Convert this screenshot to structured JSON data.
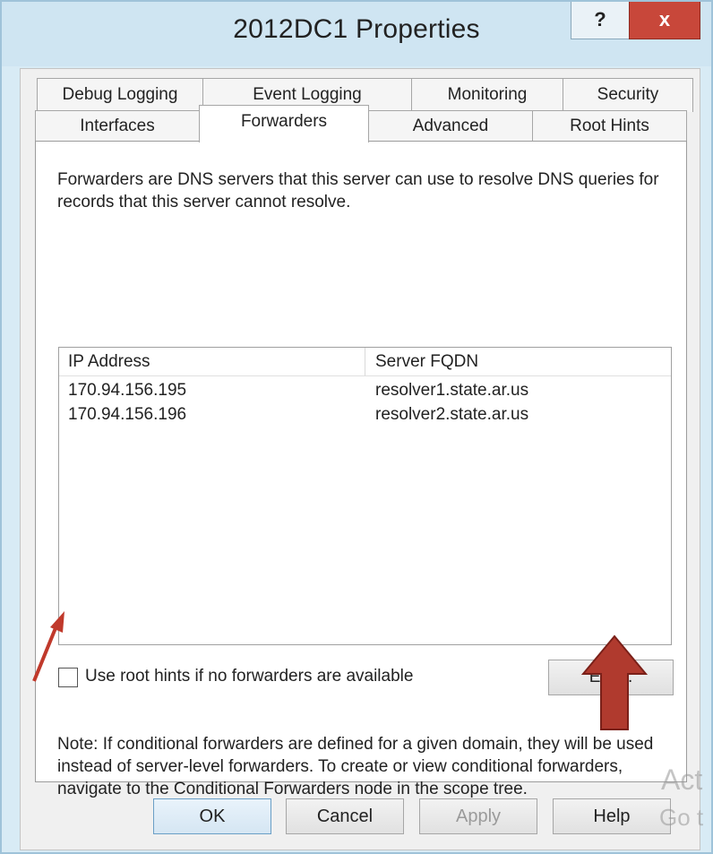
{
  "window": {
    "title": "2012DC1 Properties",
    "help_label": "?",
    "close_label": "x"
  },
  "tabs_row1": [
    {
      "label": "Debug Logging"
    },
    {
      "label": "Event Logging"
    },
    {
      "label": "Monitoring"
    },
    {
      "label": "Security"
    }
  ],
  "tabs_row2": [
    {
      "label": "Interfaces"
    },
    {
      "label": "Forwarders",
      "active": true
    },
    {
      "label": "Advanced"
    },
    {
      "label": "Root Hints"
    }
  ],
  "panel": {
    "description": "Forwarders are DNS servers that this server can use to resolve DNS queries for records that this server cannot resolve.",
    "list": {
      "columns": [
        "IP Address",
        "Server FQDN"
      ],
      "rows": [
        {
          "ip": "170.94.156.195",
          "fqdn": "resolver1.state.ar.us"
        },
        {
          "ip": "170.94.156.196",
          "fqdn": "resolver2.state.ar.us"
        }
      ]
    },
    "checkbox_label": "Use root hints if no forwarders are available",
    "checkbox_checked": false,
    "edit_label": "Edit...",
    "note": "Note: If conditional forwarders are defined for a given domain, they will be used instead of server-level forwarders.  To create or view conditional forwarders, navigate to the Conditional Forwarders node in the scope tree."
  },
  "buttons": {
    "ok": "OK",
    "cancel": "Cancel",
    "apply": "Apply",
    "help": "Help"
  },
  "watermark": {
    "line1": "Act",
    "line2": "Go t"
  },
  "colors": {
    "title_bg": "#cfe5f2",
    "close_red": "#c8473a",
    "annotation_red": "#c0392b"
  },
  "icons": {
    "help": "question-mark",
    "close": "x-mark",
    "annotation1": "red-arrow",
    "annotation2": "red-up-arrow"
  }
}
